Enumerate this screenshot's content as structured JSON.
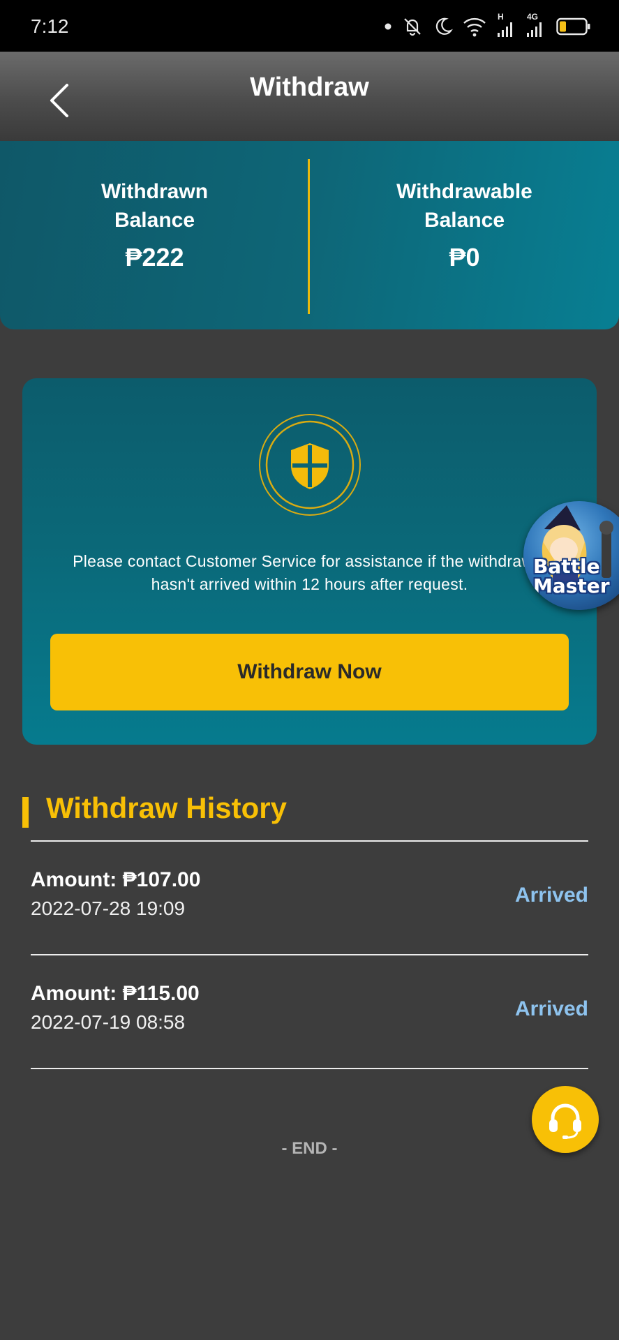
{
  "status_bar": {
    "time": "7:12",
    "network_label": "4G",
    "signal_label": "H"
  },
  "header": {
    "title": "Withdraw",
    "back_icon": "chevron-left-icon"
  },
  "balances": {
    "withdrawn_label": "Withdrawn\nBalance",
    "withdrawn_value": "₱222",
    "withdrawable_label": "Withdrawable\nBalance",
    "withdrawable_value": "₱0",
    "divider_color": "#e7b90d"
  },
  "panel": {
    "icon": "shield-icon",
    "notice": "Please contact Customer Service for assistance if the withdrawal hasn't arrived within 12 hours after request.",
    "button_label": "Withdraw Now",
    "accent_color": "#f8c006"
  },
  "game_ad": {
    "label_line1": "Battle",
    "label_line2": "Master"
  },
  "history": {
    "title": "Withdraw History",
    "rows": [
      {
        "amount": "Amount: ₱107.00",
        "date": "2022-07-28 19:09",
        "status": "Arrived"
      },
      {
        "amount": "Amount: ₱115.00",
        "date": "2022-07-19 08:58",
        "status": "Arrived"
      }
    ],
    "end_label": "- END -",
    "status_color": "#8ec3ee"
  },
  "support": {
    "icon": "headset-icon"
  }
}
